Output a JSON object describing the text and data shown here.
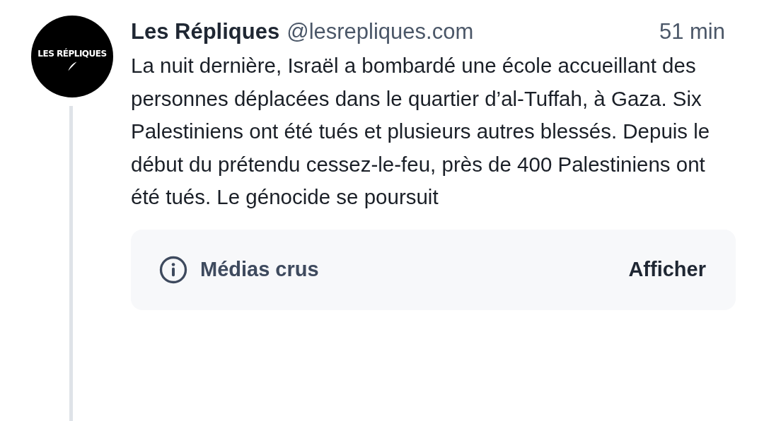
{
  "post": {
    "avatar": {
      "logo_text": "LES RÉPLIQUES"
    },
    "author": "Les Répliques",
    "handle": "@lesrepliques.com",
    "time": "51 min",
    "text": "La nuit dernière, Israël a bombardé une école accueillant des personnes déplacées dans le quartier d’al-Tuffah, à Gaza. Six Palestiniens ont été tués et plusieurs autres blessés. Depuis le début du prétendu cessez-le-feu, près de 400 Palestiniens ont été tués. Le génocide se poursuit",
    "content_warning": {
      "label": "Médias crus",
      "button": "Afficher"
    }
  }
}
